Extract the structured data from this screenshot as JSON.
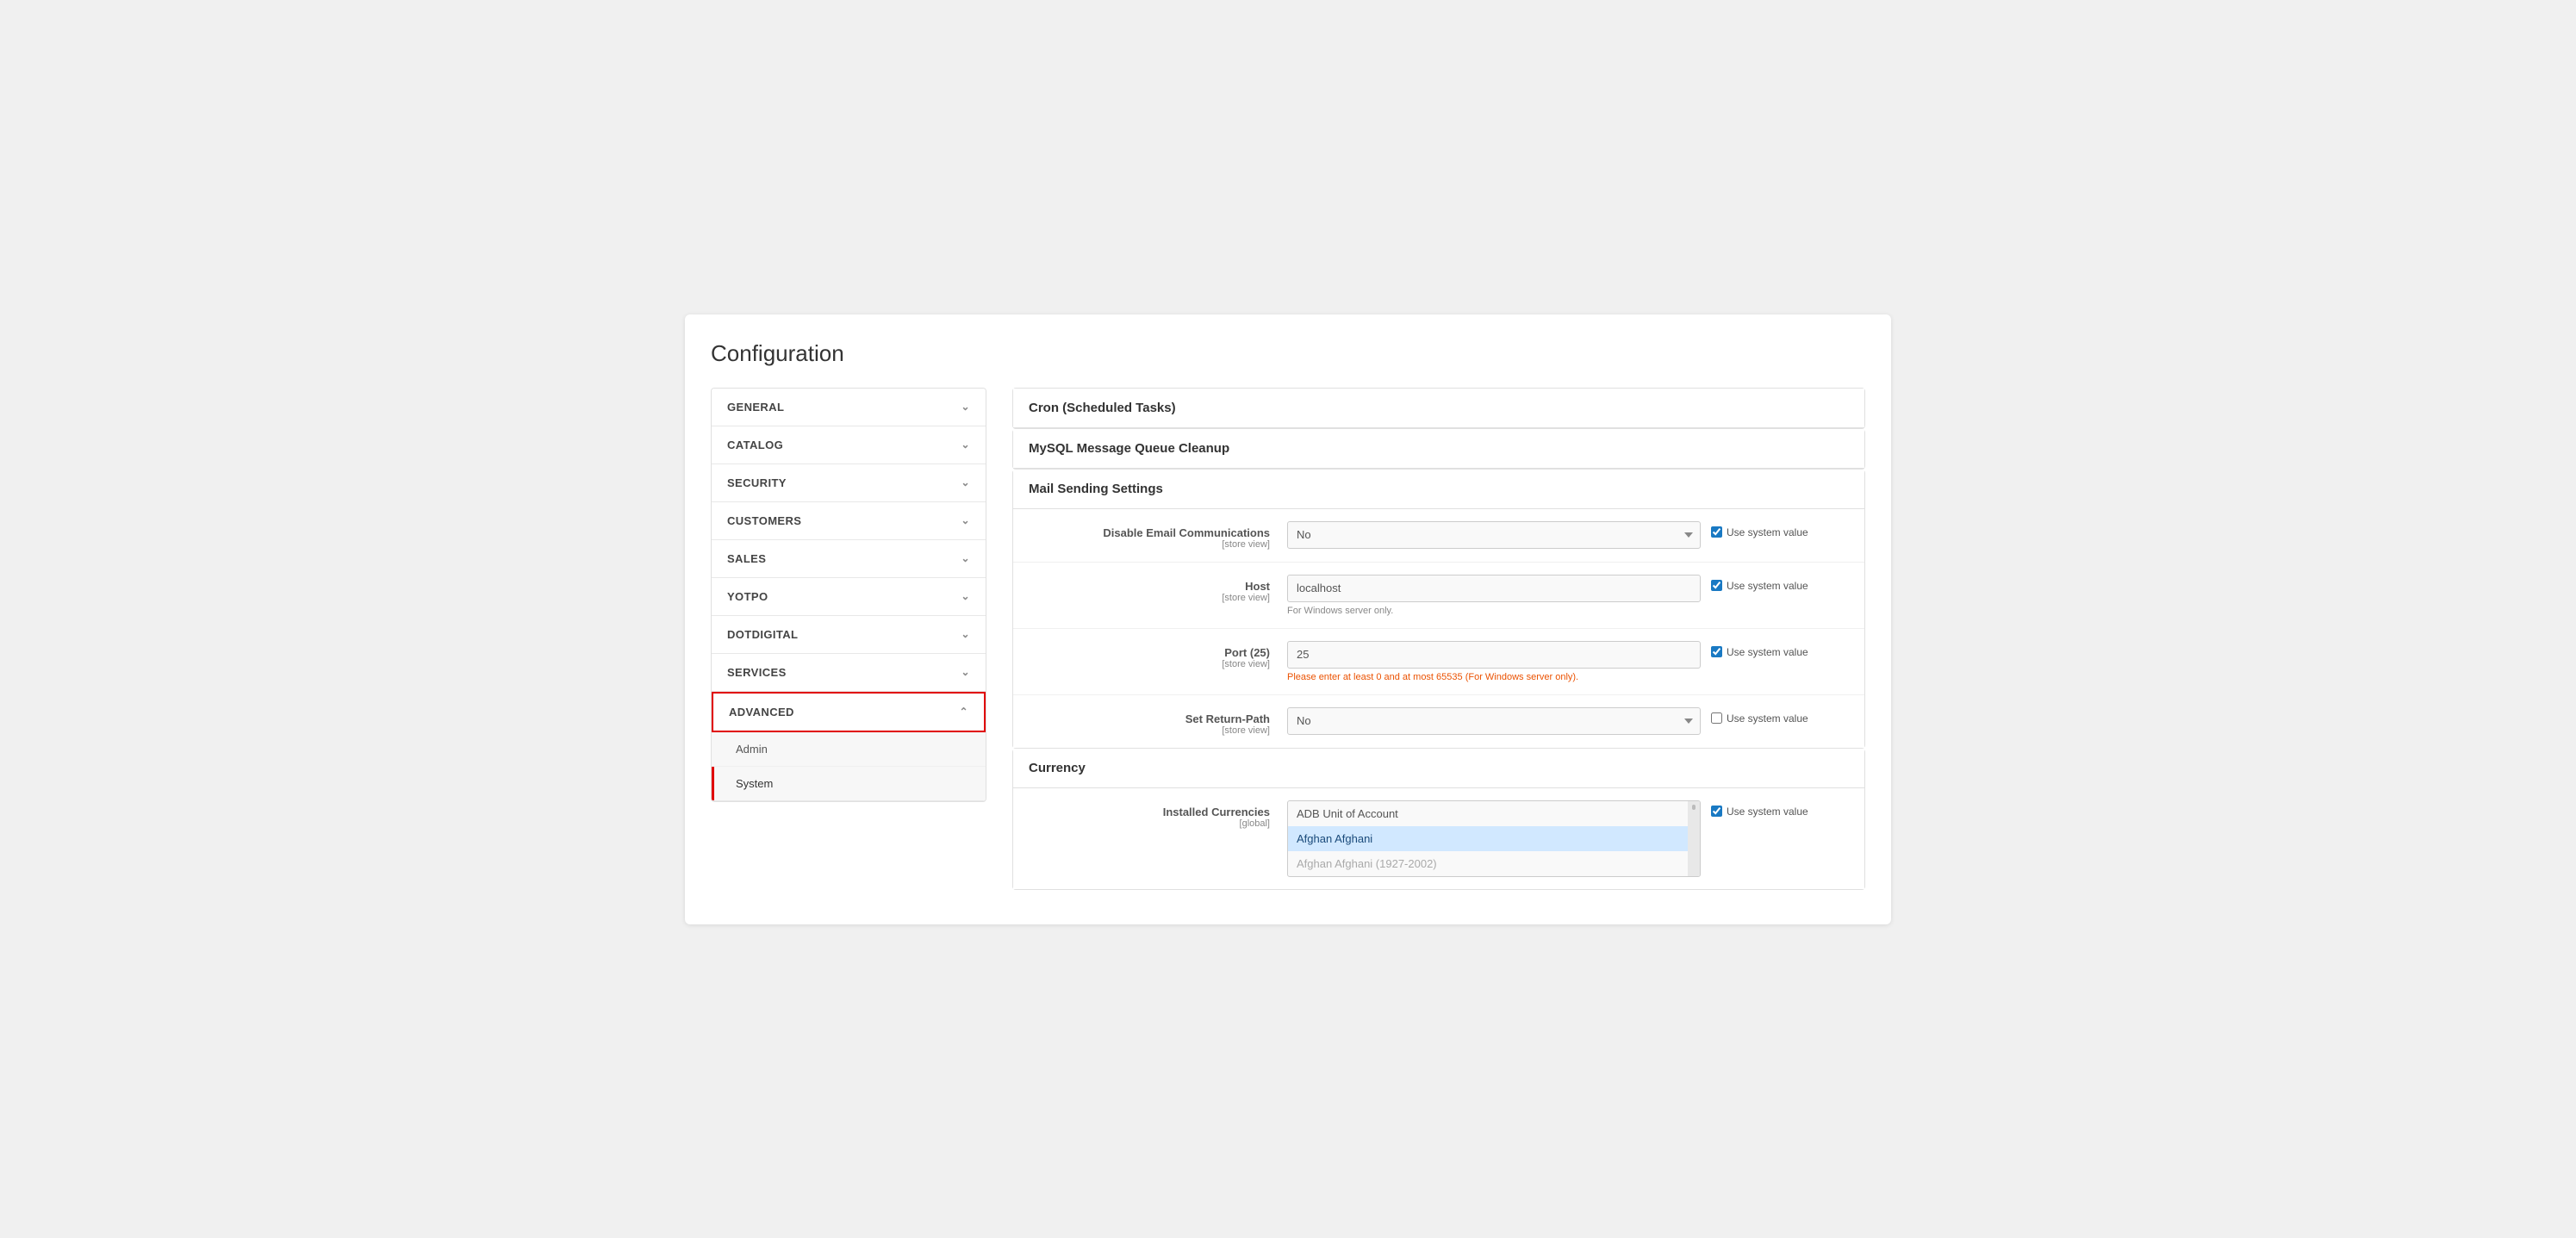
{
  "page": {
    "title": "Configuration"
  },
  "sidebar": {
    "items": [
      {
        "id": "general",
        "label": "GENERAL",
        "expanded": false,
        "active": false
      },
      {
        "id": "catalog",
        "label": "CATALOG",
        "expanded": false,
        "active": false
      },
      {
        "id": "security",
        "label": "SECURITY",
        "expanded": false,
        "active": false
      },
      {
        "id": "customers",
        "label": "CUSTOMERS",
        "expanded": false,
        "active": false
      },
      {
        "id": "sales",
        "label": "SALES",
        "expanded": false,
        "active": false
      },
      {
        "id": "yotpo",
        "label": "YOTPO",
        "expanded": false,
        "active": false
      },
      {
        "id": "dotdigital",
        "label": "DOTDIGITAL",
        "expanded": false,
        "active": false
      },
      {
        "id": "services",
        "label": "SERVICES",
        "expanded": false,
        "active": false
      },
      {
        "id": "advanced",
        "label": "ADVANCED",
        "expanded": true,
        "active": true
      }
    ],
    "sub_items": [
      {
        "id": "admin",
        "label": "Admin",
        "active": false
      },
      {
        "id": "system",
        "label": "System",
        "active": true
      }
    ]
  },
  "content": {
    "sections": [
      {
        "id": "cron",
        "title": "Cron (Scheduled Tasks)"
      },
      {
        "id": "mysql",
        "title": "MySQL Message Queue Cleanup"
      },
      {
        "id": "mail",
        "title": "Mail Sending Settings",
        "fields": [
          {
            "id": "disable_email",
            "label": "Disable Email Communications",
            "scope": "[store view]",
            "type": "select",
            "value": "No",
            "use_system_value": true,
            "hint": ""
          },
          {
            "id": "host",
            "label": "Host",
            "scope": "[store view]",
            "type": "text",
            "value": "localhost",
            "use_system_value": true,
            "hint": "For Windows server only."
          },
          {
            "id": "port",
            "label": "Port (25)",
            "scope": "[store view]",
            "type": "text",
            "value": "25",
            "use_system_value": true,
            "hint": "Please enter at least 0 and at most 65535 (For Windows server only).",
            "hint_type": "warning"
          },
          {
            "id": "return_path",
            "label": "Set Return-Path",
            "scope": "[store view]",
            "type": "select",
            "value": "No",
            "use_system_value": false,
            "hint": ""
          }
        ]
      },
      {
        "id": "currency",
        "title": "Currency",
        "fields": [
          {
            "id": "installed_currencies",
            "label": "Installed Currencies",
            "scope": "[global]",
            "type": "listbox",
            "items": [
              {
                "value": "ADB Unit of Account",
                "selected": false
              },
              {
                "value": "Afghan Afghani",
                "selected": true
              },
              {
                "value": "Afghan Afghani (1927-2002)",
                "selected": false,
                "light": true
              }
            ],
            "use_system_value": true
          }
        ]
      }
    ],
    "use_system_value_label": "Use system value"
  }
}
